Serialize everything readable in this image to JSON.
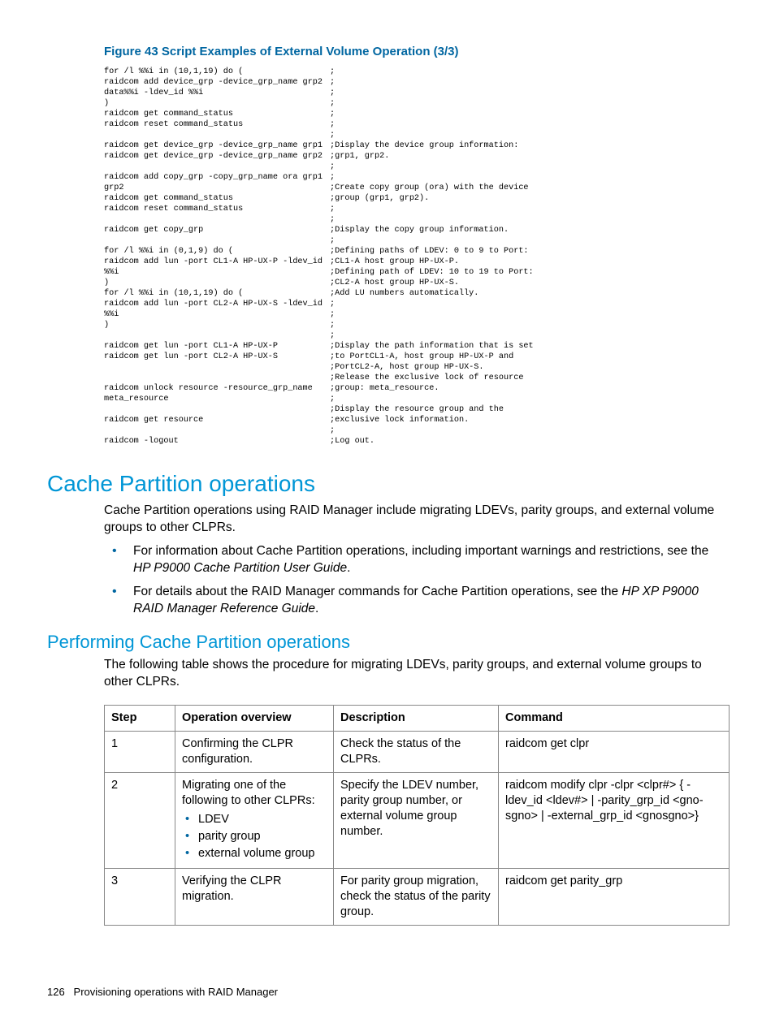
{
  "figure_title": "Figure 43 Script Examples of External Volume Operation (3/3)",
  "script": [
    {
      "l": "for /l %%i in (10,1,19) do (",
      "r": ";"
    },
    {
      "l": "raidcom add device_grp -device_grp_name grp2",
      "r": ";"
    },
    {
      "l": "data%%i -ldev_id %%i",
      "r": ";"
    },
    {
      "l": ")",
      "r": ";"
    },
    {
      "l": "raidcom get command_status",
      "r": ";"
    },
    {
      "l": "raidcom reset command_status",
      "r": ";"
    },
    {
      "l": "",
      "r": ";"
    },
    {
      "l": "raidcom get device_grp -device_grp_name grp1",
      "r": ";Display the device group information:"
    },
    {
      "l": "raidcom get device_grp -device_grp_name grp2",
      "r": ";grp1, grp2."
    },
    {
      "l": "",
      "r": ";"
    },
    {
      "l": "raidcom add copy_grp -copy_grp_name ora grp1",
      "r": ";"
    },
    {
      "l": "grp2",
      "r": ";Create copy group (ora) with the device"
    },
    {
      "l": "raidcom get command_status",
      "r": ";group (grp1, grp2)."
    },
    {
      "l": "raidcom reset command_status",
      "r": ";"
    },
    {
      "l": "",
      "r": ";"
    },
    {
      "l": "raidcom get copy_grp",
      "r": ";Display the copy group information."
    },
    {
      "l": "",
      "r": ";"
    },
    {
      "l": "for /l %%i in (0,1,9) do (",
      "r": ";Defining paths of LDEV: 0 to 9 to Port:"
    },
    {
      "l": "raidcom add lun -port CL1-A HP-UX-P -ldev_id",
      "r": ";CL1-A host group HP-UX-P."
    },
    {
      "l": "%%i",
      "r": ";Defining path of LDEV: 10 to 19 to Port:"
    },
    {
      "l": ")",
      "r": ";CL2-A host group HP-UX-S."
    },
    {
      "l": "for /l %%i in (10,1,19) do (",
      "r": ";Add LU numbers automatically."
    },
    {
      "l": "raidcom add lun -port CL2-A HP-UX-S -ldev_id",
      "r": ";"
    },
    {
      "l": "%%i",
      "r": ";"
    },
    {
      "l": ")",
      "r": ";"
    },
    {
      "l": "",
      "r": ";"
    },
    {
      "l": "raidcom get lun -port CL1-A HP-UX-P",
      "r": ";Display the path information that is set"
    },
    {
      "l": "raidcom get lun -port CL2-A HP-UX-S",
      "r": ";to PortCL1-A, host group HP-UX-P and"
    },
    {
      "l": "",
      "r": ";PortCL2-A, host group HP-UX-S."
    },
    {
      "l": "",
      "r": ";Release the exclusive lock of resource"
    },
    {
      "l": "raidcom unlock resource -resource_grp_name",
      "r": ";group: meta_resource."
    },
    {
      "l": "meta_resource",
      "r": ";"
    },
    {
      "l": "",
      "r": ";Display the resource group and the"
    },
    {
      "l": "raidcom get resource",
      "r": ";exclusive lock information."
    },
    {
      "l": "",
      "r": ";"
    },
    {
      "l": "raidcom -logout",
      "r": ";Log out."
    }
  ],
  "h1": "Cache Partition operations",
  "intro": "Cache Partition operations using RAID Manager include migrating LDEVs, parity groups, and external volume groups to other CLPRs.",
  "bullet1_pre": "For information about Cache Partition operations, including important warnings and restrictions, see the ",
  "bullet1_em": "HP P9000 Cache Partition User Guide",
  "bullet1_post": ".",
  "bullet2_pre": "For details about the RAID Manager commands for Cache Partition operations, see the ",
  "bullet2_em": "HP XP P9000 RAID Manager Reference Guide",
  "bullet2_post": ".",
  "h2": "Performing Cache Partition operations",
  "sub_intro": "The following table shows the procedure for migrating LDEVs, parity groups, and external volume groups to other CLPRs.",
  "table": {
    "headers": [
      "Step",
      "Operation overview",
      "Description",
      "Command"
    ],
    "rows": [
      {
        "step": "1",
        "op_text": "Confirming the CLPR configuration.",
        "op_items": [],
        "desc": "Check the status of the CLPRs.",
        "cmd": "raidcom get clpr"
      },
      {
        "step": "2",
        "op_text": "Migrating one of the following to other CLPRs:",
        "op_items": [
          "LDEV",
          "parity group",
          "external volume group"
        ],
        "desc": "Specify the LDEV number, parity group number, or external volume group number.",
        "cmd": "raidcom modify clpr -clpr <clpr#> { -ldev_id <ldev#> | -parity_grp_id <gno-sgno> | -external_grp_id <gnosgno>}"
      },
      {
        "step": "3",
        "op_text": "Verifying the CLPR migration.",
        "op_items": [],
        "desc": "For parity group migration, check the status of the parity group.",
        "cmd": "raidcom get parity_grp"
      }
    ]
  },
  "footer_page": "126",
  "footer_text": "Provisioning operations with RAID Manager"
}
